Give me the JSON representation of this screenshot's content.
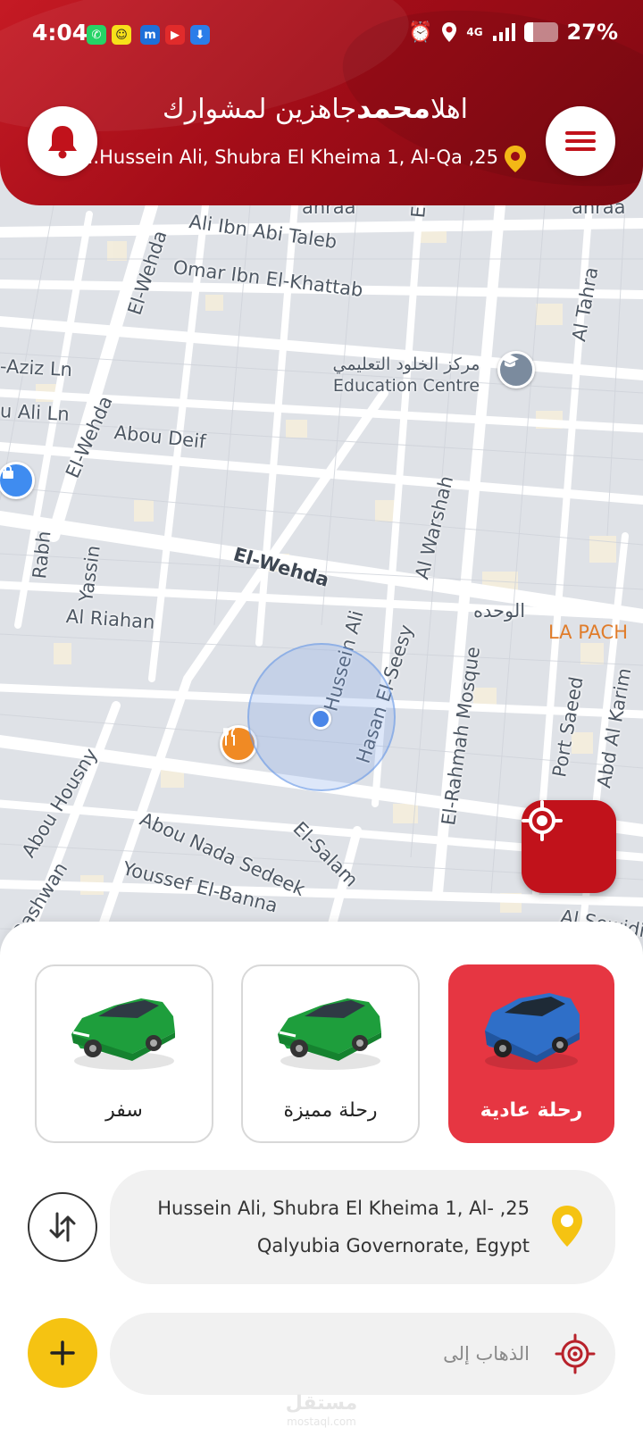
{
  "status_bar": {
    "time": "4:04",
    "network": "4G",
    "battery": "27%",
    "battery_level": 0.27
  },
  "header": {
    "greeting_prefix": "اهلا",
    "user_name": "محمد",
    "greeting_suffix": "جاهزين لمشوارك",
    "address": "...Hussein Ali, Shubra El Kheima 1, Al-Qa ,25",
    "colors": {
      "primary": "#c1121b",
      "dark": "#7d0912"
    }
  },
  "map": {
    "streets": [
      "Ali Ibn Abi Taleb",
      "Omar Ibn El-Khattab",
      "El-Wehda",
      "El-Wehda",
      "El-Wehda",
      "Abou Deif",
      "Al Warshah",
      "Al Tahra",
      "Rabh",
      "Yassin",
      "Al Riahan",
      "Hussein Ali",
      "Hasan El-Seesy",
      "El-Rahmah Mosque",
      "Port Saeed",
      "Abd Al Karim",
      "Abou Housny",
      "Abou Nada Sedeek",
      "Youssef El-Banna",
      "El-Salam",
      "Al Sewidi",
      "Rashwan",
      "الوحده",
      "-Aziz Ln",
      "u Ali Ln",
      "ahraa",
      "ahraa",
      "El"
    ],
    "poi_education": {
      "arabic": "مركز الخلود التعليمي",
      "english": "Education Centre"
    },
    "poi_right_label": "LA PACH"
  },
  "ride_types": [
    {
      "label": "سفر",
      "car": "green-car-icon",
      "active": false
    },
    {
      "label": "رحلة مميزة",
      "car": "green-car-icon",
      "active": false
    },
    {
      "label": "رحلة عادية",
      "car": "blue-suv-icon",
      "active": true
    }
  ],
  "pickup": {
    "line1": "Hussein Ali, Shubra El Kheima 1, Al- ,25",
    "line2": "Qalyubia Governorate, Egypt"
  },
  "destination": {
    "placeholder": "الذهاب إلى"
  },
  "watermark": {
    "arabic": "مستقل",
    "latin": "mostaql.com"
  },
  "icons": [
    "bell-icon",
    "menu-icon",
    "location-pin-icon",
    "locate-me-icon",
    "swap-icon",
    "plus-icon",
    "target-icon"
  ]
}
